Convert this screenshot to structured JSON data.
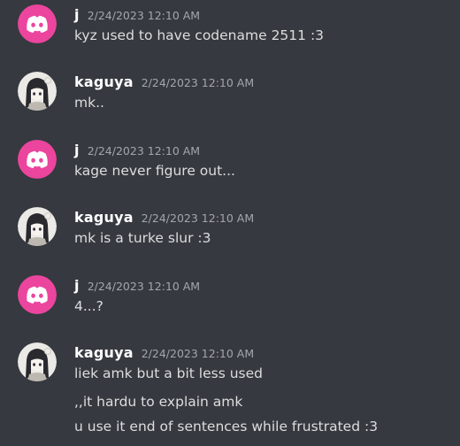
{
  "messages": [
    {
      "username": "j",
      "timestamp": "2/24/2023 12:10 AM",
      "avatar_icon": "discord-default-avatar-icon",
      "lines": [
        "kyz used to have codename 2511 :3"
      ]
    },
    {
      "username": "kaguya",
      "timestamp": "2/24/2023 12:10 AM",
      "avatar_icon": "kaguya-avatar-image",
      "lines": [
        "mk.."
      ]
    },
    {
      "username": "j",
      "timestamp": "2/24/2023 12:10 AM",
      "avatar_icon": "discord-default-avatar-icon",
      "lines": [
        "kage never figure out..."
      ]
    },
    {
      "username": "kaguya",
      "timestamp": "2/24/2023 12:10 AM",
      "avatar_icon": "kaguya-avatar-image",
      "lines": [
        "mk is a turke slur :3"
      ]
    },
    {
      "username": "j",
      "timestamp": "2/24/2023 12:10 AM",
      "avatar_icon": "discord-default-avatar-icon",
      "lines": [
        "4...?"
      ]
    },
    {
      "username": "kaguya",
      "timestamp": "2/24/2023 12:10 AM",
      "avatar_icon": "kaguya-avatar-image",
      "lines": [
        "liek amk but a bit less used",
        ",,it hardu to explain amk",
        "u use it end of sentences while frustrated :3"
      ]
    }
  ],
  "colors": {
    "background": "#36393f",
    "username": "#ffffff",
    "timestamp": "#a3a6aa",
    "message_text": "#dcddde",
    "discord_avatar": "#eb459e"
  }
}
